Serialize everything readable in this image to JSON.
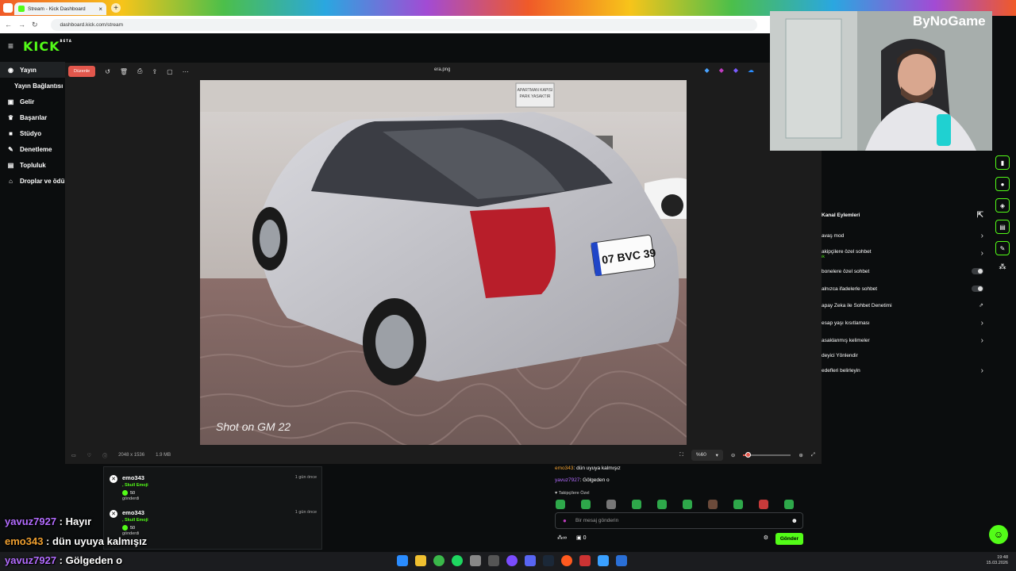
{
  "browser": {
    "tab_title": "Stream - Kick Dashboard",
    "close_label": "×",
    "new_tab_label": "+",
    "url": "dashboard.kick.com/stream"
  },
  "app": {
    "logo": "KICK",
    "logo_sup": "BETA",
    "menu_icon": "≡"
  },
  "sidebar": {
    "items": [
      {
        "label": "Yayın",
        "icon": "broadcast-icon"
      },
      {
        "label": "Yayın Bağlantısı"
      },
      {
        "label": "Gelir",
        "icon": "wallet-icon"
      },
      {
        "label": "Başarılar",
        "icon": "trophy-icon"
      },
      {
        "label": "Stüdyo",
        "icon": "camera-icon"
      },
      {
        "label": "Denetleme",
        "icon": "wrench-icon"
      },
      {
        "label": "Topluluk",
        "icon": "community-icon"
      },
      {
        "label": "Droplar ve ödü",
        "icon": "gift-icon"
      }
    ]
  },
  "viewer": {
    "edit_label": "Düzenle",
    "filename": "era.png",
    "dimensions": "2048 x 1536",
    "filesize": "1.9 MB",
    "zoom": "%60",
    "zoom_level": 0.1,
    "watermark": "Shot on GM 22",
    "plate": "07 BVC 39",
    "sign": "APARTMAN KAPISI PARK YASAKTIR"
  },
  "webcam": {
    "brand": "ByNoGame"
  },
  "channel_actions": {
    "title": "Kanal Eylemleri",
    "rows": [
      {
        "label": "avaş mod",
        "kind": "chevron"
      },
      {
        "label": "akipçilere özel sohbet",
        "sub": "ık",
        "kind": "chevron"
      },
      {
        "label": "bonelere özel sohbet",
        "kind": "toggle"
      },
      {
        "label": "alnızca ifadelerle sohbet",
        "kind": "toggle"
      },
      {
        "label": "apay Zeka ile Sohbet Denetimi",
        "kind": "external"
      },
      {
        "label": "esap yaşı kısıtlaması",
        "kind": "chevron"
      },
      {
        "label": "asaklanmış kelimeler",
        "kind": "chevron"
      },
      {
        "label": "deyici Yönlendir",
        "kind": "none"
      },
      {
        "label": "edefleri belirleyin",
        "kind": "chevron"
      }
    ]
  },
  "activity": [
    {
      "user": "emo343",
      "time": "1 gün önce",
      "emote": ", Skull Emoji",
      "amount": "50",
      "sent": "gönderdi"
    },
    {
      "user": "emo343",
      "time": "1 gün önce",
      "emote": ", Skull Emoji",
      "amount": "50",
      "sent": "gönderdi"
    }
  ],
  "chat": {
    "messages": [
      {
        "user": "emo343",
        "text": ": dün uyuya kalmışız",
        "color": "#f0a030"
      },
      {
        "user": "yavuz7927",
        "text": ": Gölgeden o",
        "color": "#b36cff"
      }
    ],
    "followers_label": "Takipçilere Özel",
    "input_placeholder": "Bir mesaj gönderin",
    "send_label": "Gönder",
    "count_value": "0"
  },
  "overlay_chat": [
    {
      "user": "yavuz7927",
      "text": " : Hayır",
      "color": "#b36cff"
    },
    {
      "user": "emo343",
      "text": " : dün uyuya kalmışız",
      "color": "#f0a030"
    },
    {
      "user": "yavuz7927",
      "text": " : Gölgeden o",
      "color": "#b36cff"
    }
  ],
  "taskbar": {
    "time": "19:48",
    "date": "15.03.2026"
  }
}
